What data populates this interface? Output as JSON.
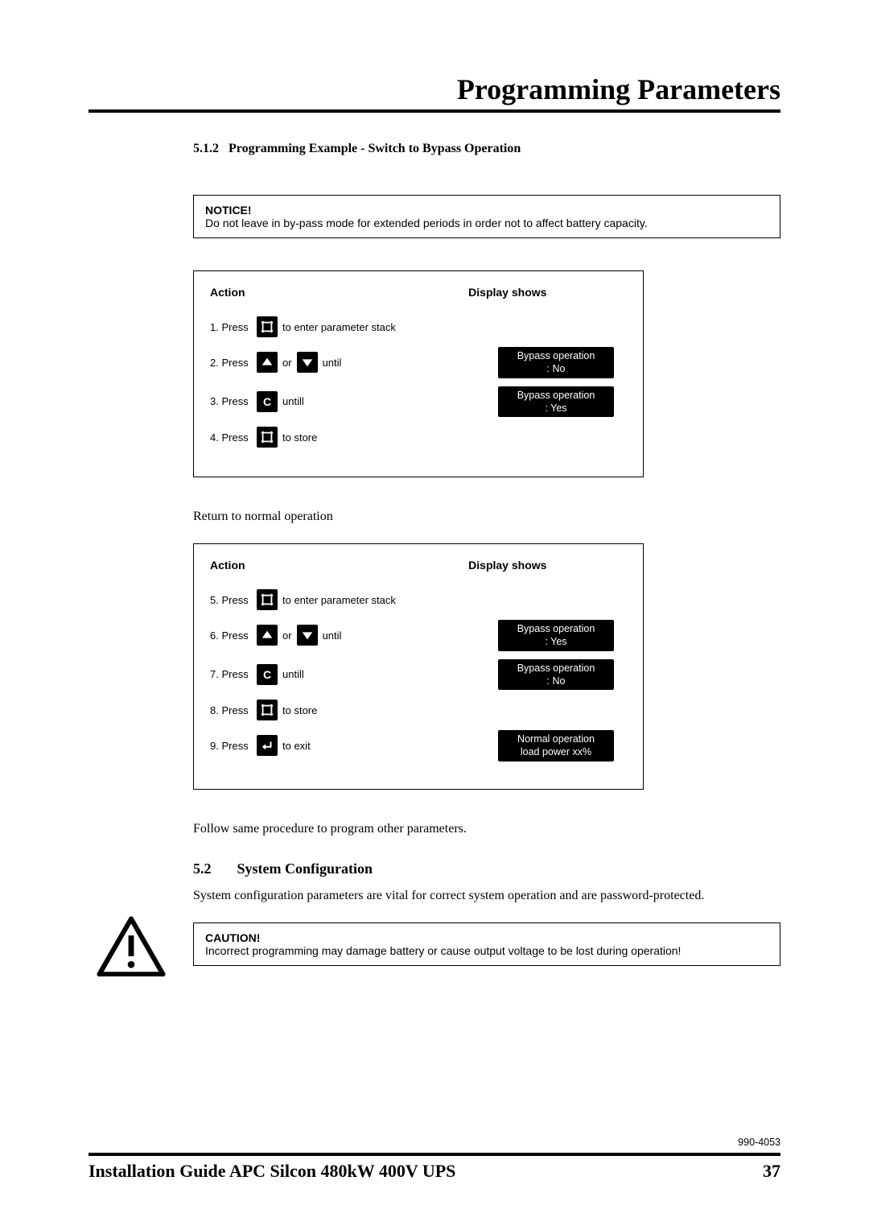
{
  "page_title": "Programming Parameters",
  "section_512": {
    "number": "5.1.2",
    "title": "Programming Example - Switch to Bypass Operation"
  },
  "notice": {
    "title": "NOTICE!",
    "body": "Do not leave in by-pass mode for extended periods in order not to affect battery capacity."
  },
  "labels": {
    "action": "Action",
    "display_shows": "Display shows",
    "press": "Press",
    "or": "or",
    "until": "until",
    "untill": "untill",
    "to_enter": "to enter parameter stack",
    "to_store": "to store",
    "to_exit": "to exit"
  },
  "proc1": {
    "step1": "1.",
    "step2": "2.",
    "step3": "3.",
    "step4": "4.",
    "lcd2_l1": "Bypass operation",
    "lcd2_l2": ": No",
    "lcd3_l1": "Bypass operation",
    "lcd3_l2": ": Yes"
  },
  "return_text": "Return to normal operation",
  "proc2": {
    "step5": "5.",
    "step6": "6.",
    "step7": "7.",
    "step8": "8.",
    "step9": "9.",
    "lcd6_l1": "Bypass operation",
    "lcd6_l2": ": Yes",
    "lcd7_l1": "Bypass operation",
    "lcd7_l2": ": No",
    "lcd9_l1": "Normal operation",
    "lcd9_l2": "load power   xx%"
  },
  "follow_text": "Follow same procedure to program other parameters.",
  "section_52": {
    "number": "5.2",
    "title": "System Configuration",
    "body": "System configuration parameters are vital for correct system operation and are password-protected."
  },
  "caution": {
    "title": "CAUTION!",
    "body": "Incorrect programming may damage battery or cause output voltage to be lost during operation!"
  },
  "doc_number": "990-4053",
  "footer_title": "Installation Guide APC Silcon 480kW 400V UPS",
  "page_number": "37"
}
